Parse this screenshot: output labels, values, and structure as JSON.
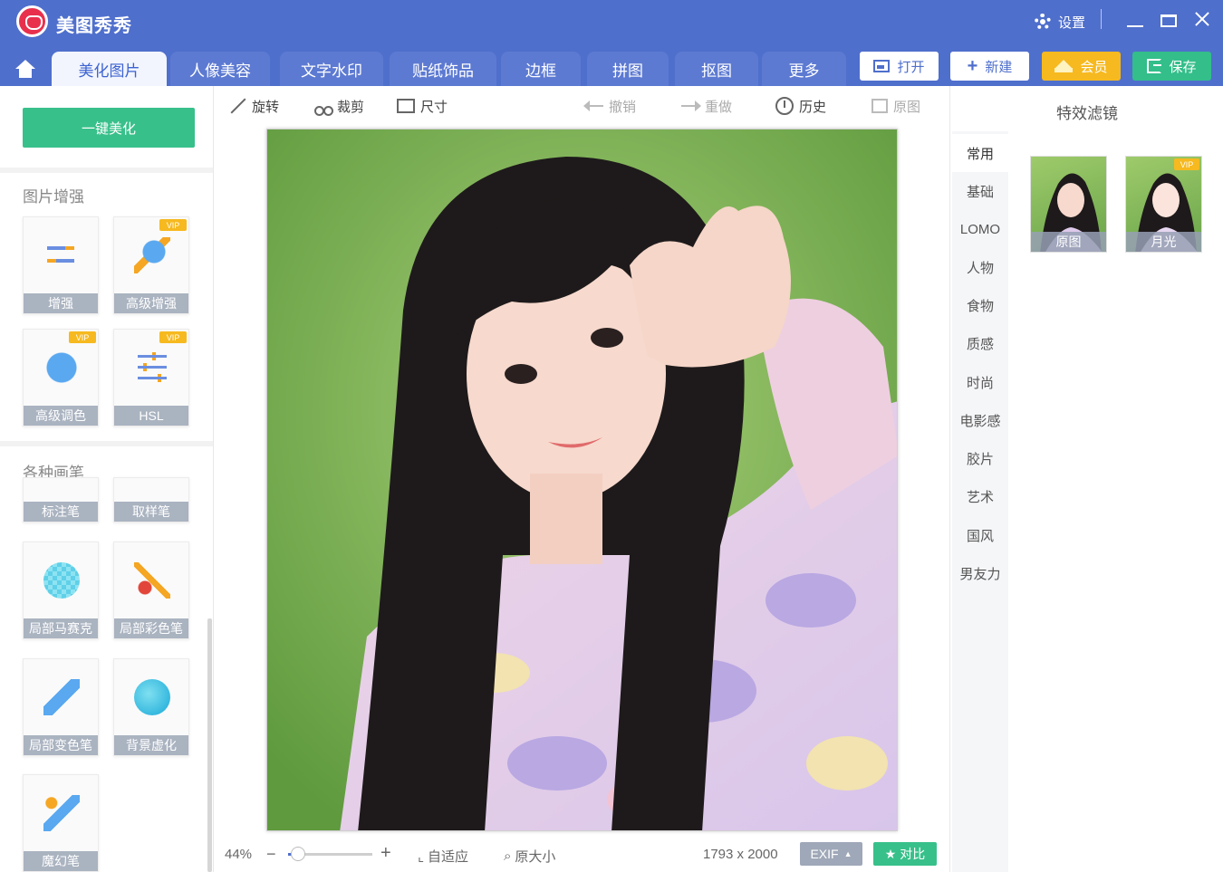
{
  "app": {
    "title": "美图秀秀",
    "settings_label": "设置"
  },
  "nav": {
    "tabs": [
      "美化图片",
      "人像美容",
      "文字水印",
      "贴纸饰品",
      "边框",
      "拼图",
      "抠图",
      "更多"
    ],
    "active_tab": "美化图片",
    "open_label": "打开",
    "new_label": "新建",
    "vip_label": "会员",
    "save_label": "保存"
  },
  "toolbar": {
    "rotate": "旋转",
    "crop": "裁剪",
    "size": "尺寸",
    "undo": "撤销",
    "redo": "重做",
    "history": "历史",
    "original": "原图"
  },
  "left": {
    "beautify_label": "一键美化",
    "enhance_section": "图片增强",
    "enhance_tools": [
      {
        "label": "增强",
        "icon": "sliders-icon",
        "vip": false
      },
      {
        "label": "高级增强",
        "icon": "magic-star-icon",
        "vip": true,
        "vip_badge": "VIP"
      },
      {
        "label": "高级调色",
        "icon": "palette-icon",
        "vip": true,
        "vip_badge": "VIP"
      },
      {
        "label": "HSL",
        "icon": "hsl-sliders-icon",
        "vip": true,
        "vip_badge": "VIP"
      }
    ],
    "brush_section": "各种画笔",
    "brush_tools": [
      {
        "label": "标注笔",
        "icon": "marker-pen-icon"
      },
      {
        "label": "取样笔",
        "icon": "sampler-pen-icon"
      },
      {
        "label": "局部马赛克",
        "icon": "mosaic-icon"
      },
      {
        "label": "局部彩色笔",
        "icon": "color-brush-icon"
      },
      {
        "label": "局部变色笔",
        "icon": "recolor-pen-icon"
      },
      {
        "label": "背景虚化",
        "icon": "blur-icon"
      },
      {
        "label": "魔幻笔",
        "icon": "magic-pen-icon"
      }
    ]
  },
  "canvas": {
    "zoom": "44%",
    "fit_label": "自适应",
    "actual_size_label": "原大小",
    "dimensions": "1793 x 2000",
    "exif_label": "EXIF",
    "compare_label": "对比",
    "zoom_fraction": 0.12
  },
  "right": {
    "title": "特效滤镜",
    "categories": [
      "常用",
      "基础",
      "LOMO",
      "人物",
      "食物",
      "质感",
      "时尚",
      "电影感",
      "胶片",
      "艺术",
      "国风",
      "男友力"
    ],
    "active_category": "常用",
    "filters": [
      {
        "label": "原图",
        "vip": false
      },
      {
        "label": "月光",
        "vip": true,
        "vip_badge": "VIP"
      }
    ]
  },
  "colors": {
    "brand": "#4f6fcc",
    "accent_green": "#38c08a",
    "vip_gold": "#f6b91f"
  }
}
